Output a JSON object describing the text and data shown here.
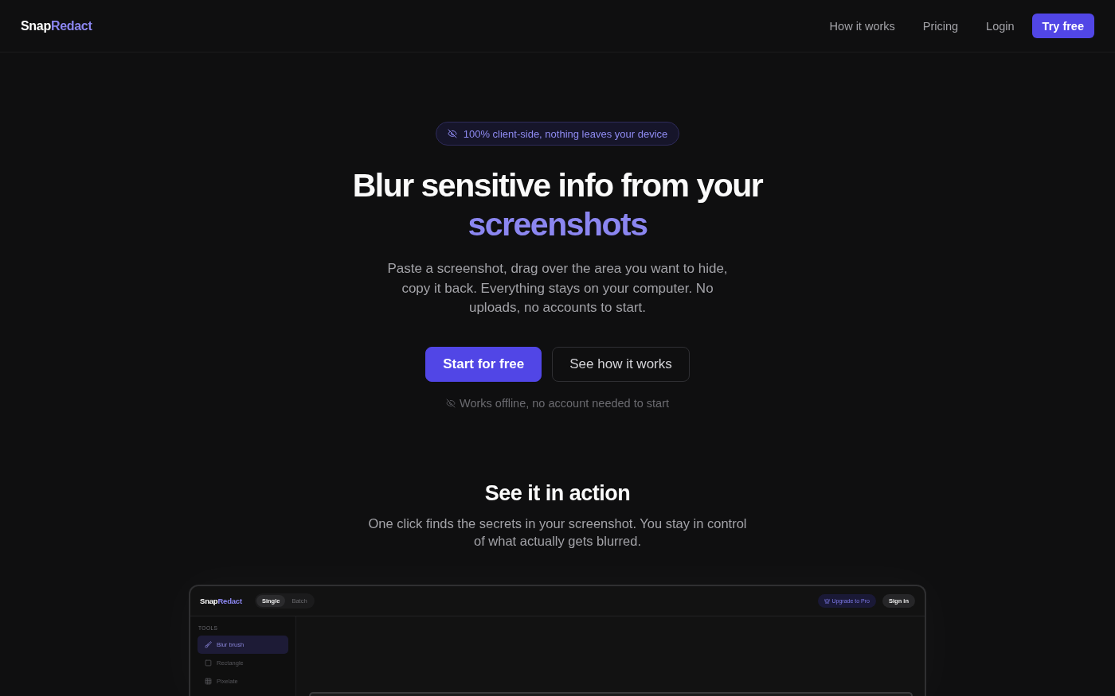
{
  "nav": {
    "logo": {
      "first": "Snap",
      "second": "Redact"
    },
    "links": [
      {
        "label": "How it works"
      },
      {
        "label": "Pricing"
      },
      {
        "label": "Login"
      }
    ],
    "cta": "Try free"
  },
  "hero": {
    "badge": "100% client-side, nothing leaves your device",
    "title": "Blur sensitive info from your",
    "title_highlight": "screenshots",
    "description": "Paste a screenshot, drag over the area you want to hide, copy it back. Everything stays on your computer. No uploads, no accounts to start.",
    "buttons": [
      {
        "label": "Start for free",
        "kind": "primary"
      },
      {
        "label": "See how it works",
        "kind": "secondary"
      }
    ],
    "note": "Works offline, no account needed to start"
  },
  "demo": {
    "title": "See it in action",
    "description": "One click finds the secrets in your screenshot. You stay in control of what actually gets blurred.",
    "app": {
      "logo": {
        "first": "Snap",
        "second": "Redact"
      },
      "modes": [
        {
          "label": "Single",
          "selected": true
        },
        {
          "label": "Batch",
          "selected": false
        }
      ],
      "upgrade": "Upgrade to Pro",
      "sign_in": "Sign in",
      "sidebar": {
        "heading": "TOOLS",
        "tools": [
          {
            "label": "Blur brush",
            "selected": true
          },
          {
            "label": "Rectangle",
            "selected": false
          },
          {
            "label": "Pixelate",
            "selected": false
          }
        ]
      }
    }
  }
}
